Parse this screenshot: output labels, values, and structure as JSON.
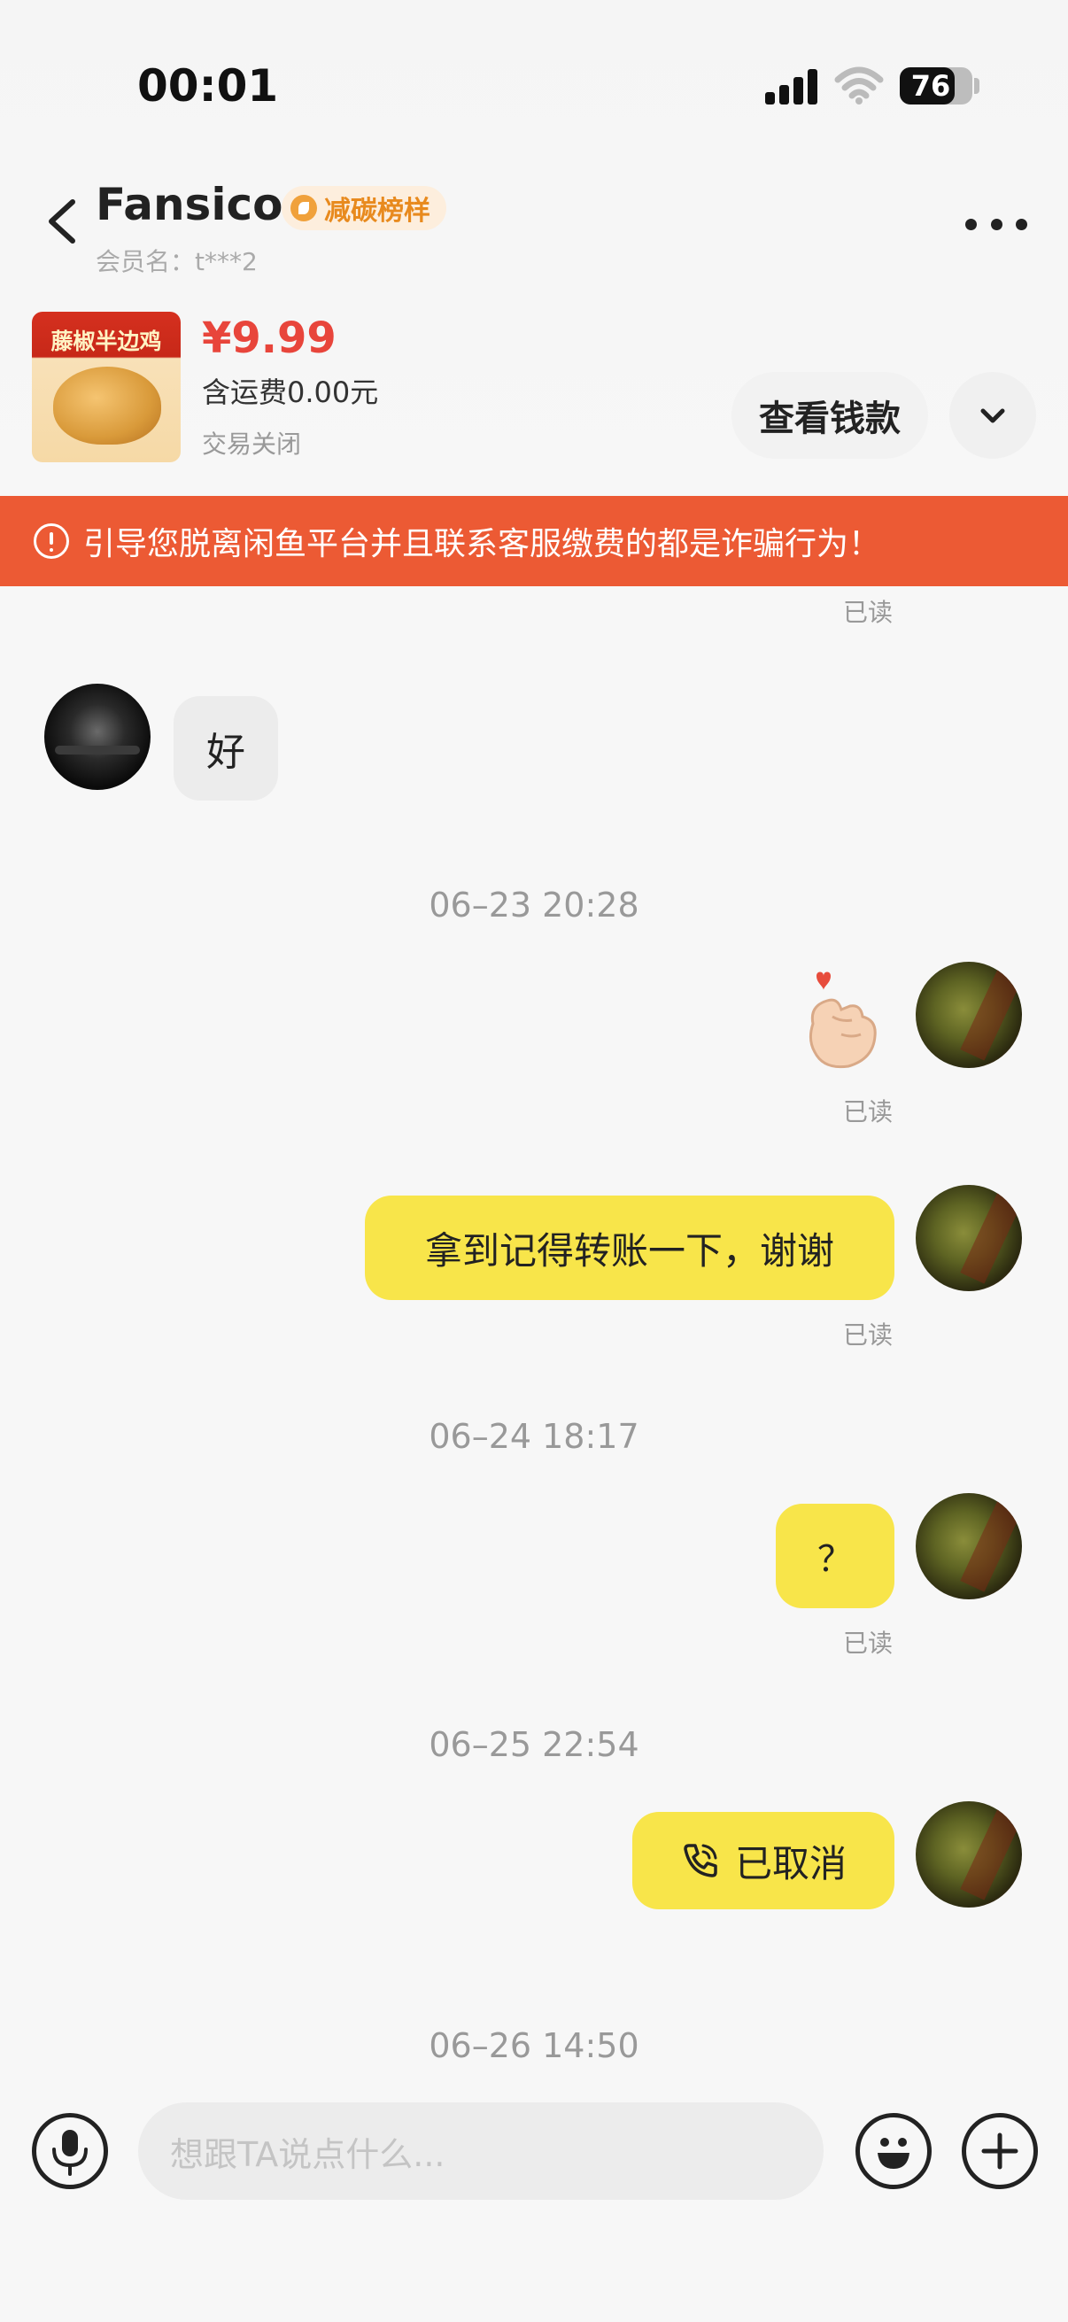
{
  "status_bar": {
    "time": "00:01",
    "battery": "76",
    "battery_level": 0.76
  },
  "nav": {
    "name": "Fansico",
    "badge": "减碳榜样",
    "member_label": "会员名：t***2"
  },
  "product": {
    "thumb_title": "藤椒半边鸡",
    "price": "¥9.99",
    "shipping": "含运费0.00元",
    "status": "交易关闭",
    "view_button": "查看钱款"
  },
  "warning": "引导您脱离闲鱼平台并且联系客服缴费的都是诈骗行为！",
  "messages": {
    "read_label": "已读",
    "other_msg": "好",
    "ts1": "06–23 20:28",
    "msg2": "拿到记得转账一下，谢谢",
    "ts2": "06–24 18:17",
    "msg3": "？",
    "ts3": "06–25 22:54",
    "call": "已取消",
    "ts4": "06–26 14:50"
  },
  "input": {
    "placeholder": "想跟TA说点什么..."
  },
  "icons": [
    "back-icon",
    "more-icon",
    "expand-icon",
    "warning-icon",
    "heart-hand-icon",
    "phone-icon",
    "mic-icon",
    "emoji-icon",
    "plus-icon"
  ]
}
